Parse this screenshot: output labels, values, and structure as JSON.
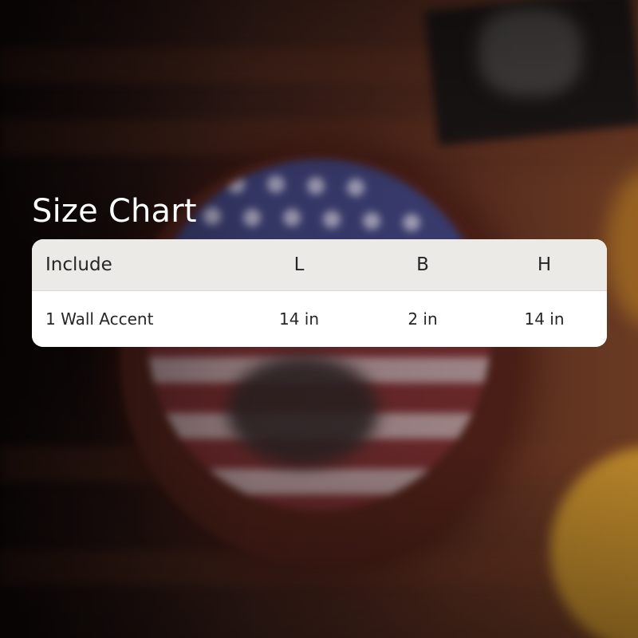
{
  "size_chart": {
    "title": "Size Chart",
    "headers": [
      "Include",
      "L",
      "B",
      "H"
    ],
    "rows": [
      [
        "1 Wall Accent",
        "14 in",
        "2 in",
        "14 in"
      ]
    ]
  }
}
